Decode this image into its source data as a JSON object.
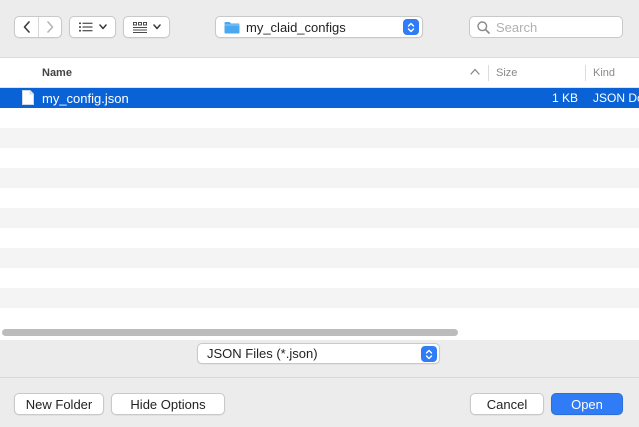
{
  "toolbar": {
    "back_icon": "chevron-left-icon",
    "forward_icon": "chevron-right-icon",
    "view_icon": "list-view-icon",
    "group_icon": "grid-view-icon",
    "location": "my_claid_configs",
    "search_placeholder": "Search"
  },
  "list": {
    "columns": {
      "name": "Name",
      "size": "Size",
      "kind": "Kind"
    },
    "files": [
      {
        "name": "my_config.json",
        "size": "1 KB",
        "kind": "JSON Document",
        "selected": true
      }
    ]
  },
  "file_type": {
    "selected": "JSON Files (*.json)"
  },
  "buttons": {
    "new_folder": "New Folder",
    "hide_options": "Hide Options",
    "cancel": "Cancel",
    "open": "Open"
  },
  "colors": {
    "accent": "#2f7cf6",
    "selection": "#0a63d6",
    "folder": "#4aa8f0"
  }
}
